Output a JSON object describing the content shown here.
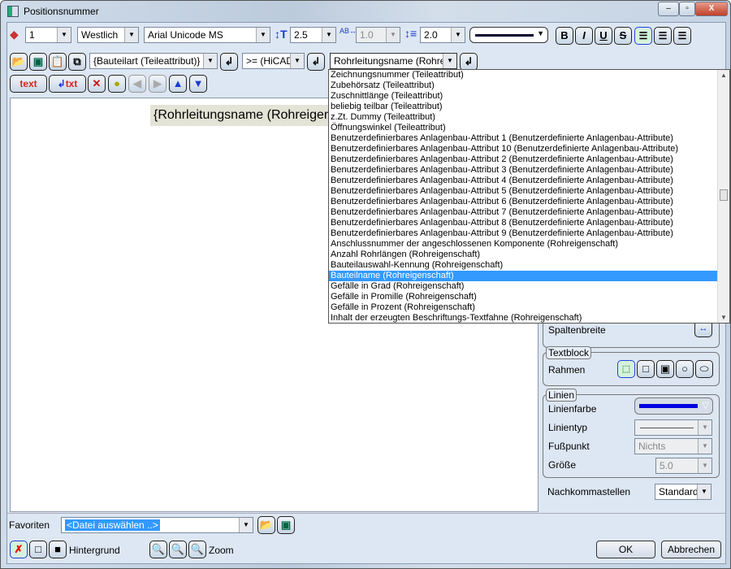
{
  "window": {
    "title": "Positionsnummer",
    "minimize": "–",
    "maximize": "▫",
    "close": "X"
  },
  "toolbar1": {
    "layer": "1",
    "direction": "Westlich",
    "font": "Arial Unicode MS",
    "height": "2.5",
    "spacing": "1.0",
    "line_spacing": "2.0",
    "bold": "B",
    "italic": "I",
    "underline": "U",
    "strike": "S"
  },
  "toolbar2": {
    "attribute": "{Bauteilart (Teileattribut)}",
    "operator": ">= (HiCAD",
    "property": "Rohrleitungsname (Rohreige"
  },
  "toolbar3": {
    "text_btn": "text",
    "txt_btn": "txt"
  },
  "editor": {
    "text": "{Rohrleitungsname (Rohreigen"
  },
  "dropdown": {
    "selected_index": 19,
    "items": [
      "Zeichnungsnummer (Teileattribut)",
      "Zubehörsatz (Teileattribut)",
      "Zuschnittlänge (Teileattribut)",
      "beliebig teilbar (Teileattribut)",
      "z.Zt. Dummy (Teileattribut)",
      "Öffnungswinkel (Teileattribut)",
      "Benutzerdefinierbares Anlagenbau-Attribut 1 (Benutzerdefinierte Anlagenbau-Attribute)",
      "Benutzerdefinierbares Anlagenbau-Attribut 10 (Benutzerdefinierte Anlagenbau-Attribute)",
      "Benutzerdefinierbares Anlagenbau-Attribut 2 (Benutzerdefinierte Anlagenbau-Attribute)",
      "Benutzerdefinierbares Anlagenbau-Attribut 3 (Benutzerdefinierte Anlagenbau-Attribute)",
      "Benutzerdefinierbares Anlagenbau-Attribut 4 (Benutzerdefinierte Anlagenbau-Attribute)",
      "Benutzerdefinierbares Anlagenbau-Attribut 5 (Benutzerdefinierte Anlagenbau-Attribute)",
      "Benutzerdefinierbares Anlagenbau-Attribut 6 (Benutzerdefinierte Anlagenbau-Attribute)",
      "Benutzerdefinierbares Anlagenbau-Attribut 7 (Benutzerdefinierte Anlagenbau-Attribute)",
      "Benutzerdefinierbares Anlagenbau-Attribut 8 (Benutzerdefinierte Anlagenbau-Attribute)",
      "Benutzerdefinierbares Anlagenbau-Attribut 9 (Benutzerdefinierte Anlagenbau-Attribute)",
      "Anschlussnummer der angeschlossenen Komponente (Rohreigenschaft)",
      "Anzahl Rohrlängen (Rohreigenschaft)",
      "Bauteilauswahl-Kennung (Rohreigenschaft)",
      "Bauteilname (Rohreigenschaft)",
      "Gefälle in Grad (Rohreigenschaft)",
      "Gefälle in Promille (Rohreigenschaft)",
      "Gefälle in Prozent (Rohreigenschaft)",
      "Inhalt der erzeugten Beschriftungs-Textfahne (Rohreigenschaft)"
    ]
  },
  "panel": {
    "spaltenbreite": "Spaltenbreite",
    "textblock": "Textblock",
    "rahmen": "Rahmen",
    "linien": "Linien",
    "linienfarbe": "Linienfarbe",
    "linienfarbe_color": "#0000e0",
    "linientyp": "Linientyp",
    "fusspunkt": "Fußpunkt",
    "fusspunkt_value": "Nichts",
    "groesse": "Größe",
    "groesse_value": "5.0",
    "nachkommastellen": "Nachkommastellen",
    "nachkommastellen_value": "Standard"
  },
  "bottom": {
    "favoriten": "Favoriten",
    "file": "<Datei auswählen ..>",
    "hintergrund": "Hintergrund",
    "zoom": "Zoom",
    "ok": "OK",
    "cancel": "Abbrechen"
  }
}
